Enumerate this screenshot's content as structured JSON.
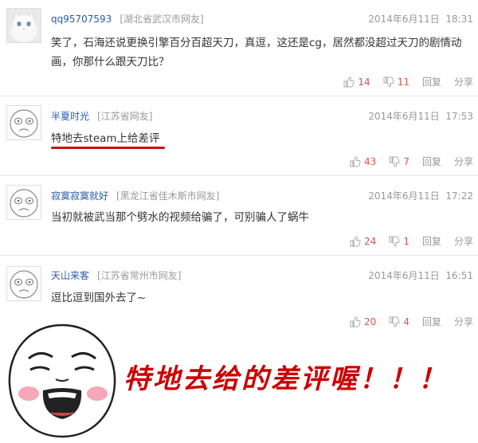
{
  "comments": [
    {
      "username": "qq95707593",
      "location": "[湖北省武汉市网友]",
      "time": "2014年6月11日",
      "clock": "18:31",
      "text": "笑了，石海还说更换引擎百分百超天刀，真逗，这还是cg，居然都没超过天刀的剧情动画，你那什么跟天刀比？",
      "upvotes": "14",
      "downvotes": "11",
      "reply": "回复",
      "share": "分享",
      "avatar": "cat-avatar"
    },
    {
      "username": "半夏时光",
      "location": "[江苏省网友]",
      "time": "2014年6月11日",
      "clock": "17:53",
      "text": "特地去steam上给差评",
      "upvotes": "43",
      "downvotes": "7",
      "reply": "回复",
      "share": "分享",
      "avatar": "default-face-avatar"
    },
    {
      "username": "寂寞寂寞就好",
      "location": "[黑龙江省佳木斯市网友]",
      "time": "2014年6月11日",
      "clock": "17:22",
      "text": "当初就被武当那个劈水的视频给骗了，可别骗人了蜗牛",
      "upvotes": "24",
      "downvotes": "1",
      "reply": "回复",
      "share": "分享",
      "avatar": "default-face-avatar"
    },
    {
      "username": "天山来客",
      "location": "[江苏省常州市网友]",
      "time": "2014年6月11日",
      "clock": "16:51",
      "text": "逗比逗到国外去了~",
      "upvotes": "20",
      "downvotes": "4",
      "reply": "回复",
      "share": "分享",
      "avatar": "default-face-avatar"
    }
  ],
  "overlay": {
    "caption": "特地去给的差评喔！！！",
    "caption_color": "#cc0000",
    "meme": "laughing-meme-face"
  },
  "colors": {
    "username": "#2a5ca8",
    "meta": "#999999",
    "vote_count": "#d9534f",
    "highlight_underline": "#cc1111"
  }
}
